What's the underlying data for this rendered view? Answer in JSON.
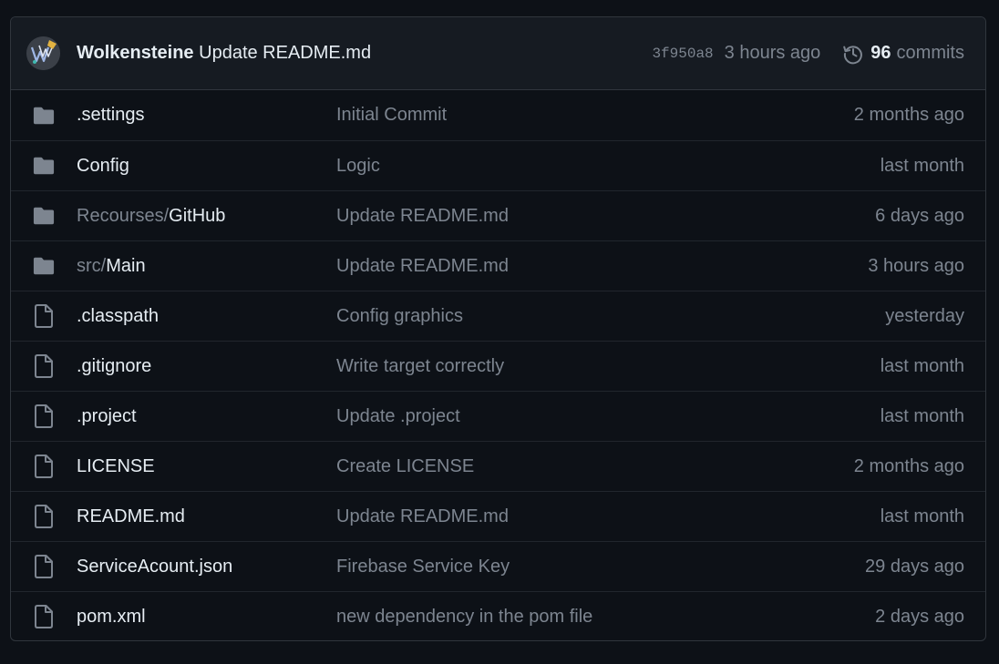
{
  "latest_commit": {
    "author": "Wolkensteine",
    "message": "Update README.md",
    "sha": "3f950a8",
    "time": "3 hours ago",
    "commits_count": "96",
    "commits_label": "commits"
  },
  "files": [
    {
      "type": "folder",
      "prefix": "",
      "name": ".settings",
      "message": "Initial Commit",
      "age": "2 months ago"
    },
    {
      "type": "folder",
      "prefix": "",
      "name": "Config",
      "message": "Logic",
      "age": "last month"
    },
    {
      "type": "folder",
      "prefix": "Recourses/",
      "name": "GitHub",
      "message": "Update README.md",
      "age": "6 days ago"
    },
    {
      "type": "folder",
      "prefix": "src/",
      "name": "Main",
      "message": "Update README.md",
      "age": "3 hours ago"
    },
    {
      "type": "file",
      "prefix": "",
      "name": ".classpath",
      "message": "Config graphics",
      "age": "yesterday"
    },
    {
      "type": "file",
      "prefix": "",
      "name": ".gitignore",
      "message": "Write target correctly",
      "age": "last month"
    },
    {
      "type": "file",
      "prefix": "",
      "name": ".project",
      "message": "Update .project",
      "age": "last month"
    },
    {
      "type": "file",
      "prefix": "",
      "name": "LICENSE",
      "message": "Create LICENSE",
      "age": "2 months ago"
    },
    {
      "type": "file",
      "prefix": "",
      "name": "README.md",
      "message": "Update README.md",
      "age": "last month"
    },
    {
      "type": "file",
      "prefix": "",
      "name": "ServiceAcount.json",
      "message": "Firebase Service Key",
      "age": "29 days ago"
    },
    {
      "type": "file",
      "prefix": "",
      "name": "pom.xml",
      "message": "new dependency in the pom file",
      "age": "2 days ago"
    }
  ],
  "colors": {
    "background": "#0d1117",
    "header_background": "#161b22",
    "border": "#30363d",
    "text_primary": "#e6edf3",
    "text_muted": "#7d8590",
    "icon": "#7d8590"
  },
  "icons": {
    "folder": "folder-icon",
    "file": "file-icon",
    "history": "history-icon",
    "avatar": "avatar"
  }
}
